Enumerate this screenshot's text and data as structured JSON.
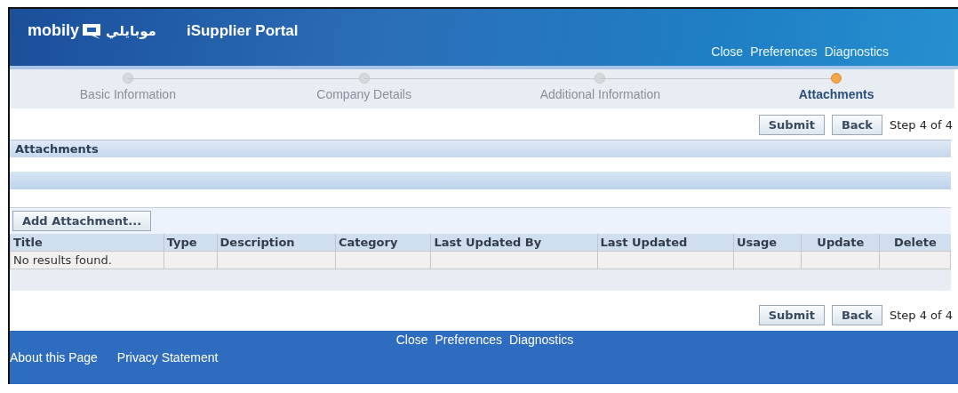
{
  "header": {
    "brand": "mobily",
    "brand_arabic": "موبايلي",
    "title": "iSupplier Portal",
    "links": [
      "Close",
      "Preferences",
      "Diagnostics"
    ]
  },
  "train": [
    {
      "label": "Basic Information",
      "selected": false
    },
    {
      "label": "Company Details",
      "selected": false
    },
    {
      "label": "Additional Information",
      "selected": false
    },
    {
      "label": "Attachments",
      "selected": true
    }
  ],
  "top_actions": {
    "buttons": [
      "Submit",
      "Back"
    ],
    "step": "Step 4 of 4"
  },
  "section": {
    "title": "Attachments"
  },
  "add_button": "Add Attachment...",
  "table": {
    "columns": [
      "Title",
      "Type",
      "Description",
      "Category",
      "Last Updated By",
      "Last Updated",
      "Usage",
      "Update",
      "Delete"
    ],
    "empty_text": "No results found."
  },
  "bottom_actions": {
    "buttons": [
      "Submit",
      "Back"
    ],
    "step": "Step 4 of 4"
  },
  "footer": {
    "links": [
      "Close",
      "Preferences",
      "Diagnostics"
    ],
    "bottom_links": [
      "About this Page",
      "Privacy Statement"
    ]
  }
}
